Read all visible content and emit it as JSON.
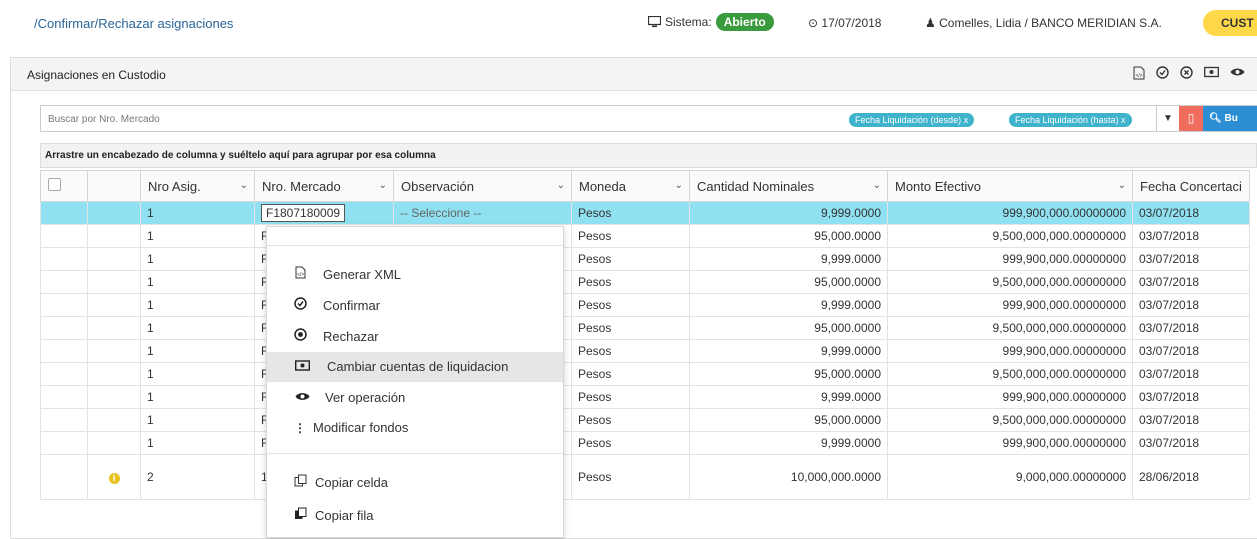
{
  "header": {
    "breadcrumb": "/Confirmar/Rechazar asignaciones",
    "system_label": "Sistema:",
    "system_status": "Abierto",
    "date": "17/07/2018",
    "user": "Comelles, Lidia / BANCO MERIDIAN S.A.",
    "role_badge": "CUST"
  },
  "panel": {
    "title": "Asignaciones en Custodio"
  },
  "search": {
    "placeholder": "Buscar por Nro. Mercado",
    "chips": [
      "Fecha Liquidación (desde) x",
      "Fecha Liquidación (hasta) x"
    ],
    "find_label": "Bu"
  },
  "group_hint": "Arrastre un encabezado de columna y suéltelo aquí para agrupar por esa columna",
  "columns": [
    "Nro Asig.",
    "Nro. Mercado",
    "Observación",
    "Moneda",
    "Cantidad Nominales",
    "Monto Efectivo",
    "Fecha Concertaci"
  ],
  "rows": [
    {
      "asig": "1",
      "mercado": "F1807180009",
      "obs": "-- Seleccione --",
      "moneda": "Pesos",
      "cantidad": "9,999.0000",
      "monto": "999,900,000.00000000",
      "fecha": "03/07/2018",
      "info": false
    },
    {
      "asig": "1",
      "mercado": "F",
      "obs": "",
      "moneda": "Pesos",
      "cantidad": "95,000.0000",
      "monto": "9,500,000,000.00000000",
      "fecha": "03/07/2018",
      "info": false
    },
    {
      "asig": "1",
      "mercado": "F",
      "obs": "",
      "moneda": "Pesos",
      "cantidad": "9,999.0000",
      "monto": "999,900,000.00000000",
      "fecha": "03/07/2018",
      "info": false
    },
    {
      "asig": "1",
      "mercado": "F",
      "obs": "",
      "moneda": "Pesos",
      "cantidad": "95,000.0000",
      "monto": "9,500,000,000.00000000",
      "fecha": "03/07/2018",
      "info": false
    },
    {
      "asig": "1",
      "mercado": "F",
      "obs": "",
      "moneda": "Pesos",
      "cantidad": "9,999.0000",
      "monto": "999,900,000.00000000",
      "fecha": "03/07/2018",
      "info": false
    },
    {
      "asig": "1",
      "mercado": "F",
      "obs": "",
      "moneda": "Pesos",
      "cantidad": "95,000.0000",
      "monto": "9,500,000,000.00000000",
      "fecha": "03/07/2018",
      "info": false
    },
    {
      "asig": "1",
      "mercado": "F",
      "obs": "",
      "moneda": "Pesos",
      "cantidad": "9,999.0000",
      "monto": "999,900,000.00000000",
      "fecha": "03/07/2018",
      "info": false
    },
    {
      "asig": "1",
      "mercado": "F",
      "obs": "",
      "moneda": "Pesos",
      "cantidad": "95,000.0000",
      "monto": "9,500,000,000.00000000",
      "fecha": "03/07/2018",
      "info": false
    },
    {
      "asig": "1",
      "mercado": "F",
      "obs": "",
      "moneda": "Pesos",
      "cantidad": "9,999.0000",
      "monto": "999,900,000.00000000",
      "fecha": "03/07/2018",
      "info": false
    },
    {
      "asig": "1",
      "mercado": "F",
      "obs": "",
      "moneda": "Pesos",
      "cantidad": "95,000.0000",
      "monto": "9,500,000,000.00000000",
      "fecha": "03/07/2018",
      "info": false
    },
    {
      "asig": "1",
      "mercado": "F",
      "obs": "",
      "moneda": "Pesos",
      "cantidad": "9,999.0000",
      "monto": "999,900,000.00000000",
      "fecha": "03/07/2018",
      "info": false
    },
    {
      "asig": "2",
      "mercado": "1",
      "obs": "",
      "moneda": "Pesos",
      "cantidad": "10,000,000.0000",
      "monto": "9,000,000.00000000",
      "fecha": "28/06/2018",
      "info": true
    }
  ],
  "context_menu": {
    "items": [
      {
        "label": "Generar XML",
        "icon": "xml-file-icon"
      },
      {
        "label": "Confirmar",
        "icon": "check-circle-icon"
      },
      {
        "label": "Rechazar",
        "icon": "x-circle-icon"
      },
      {
        "label": "Cambiar cuentas de liquidacion",
        "icon": "money-icon",
        "highlighted": true
      },
      {
        "label": "Ver operación",
        "icon": "eye-icon"
      },
      {
        "label": "Modificar fondos",
        "icon": "vertical-dots-icon"
      },
      {
        "label": "Copiar celda",
        "icon": "copy-icon"
      },
      {
        "label": "Copiar fila",
        "icon": "copy-row-icon"
      }
    ]
  },
  "colors": {
    "selected_row": "#8fe0f0",
    "open_badge": "#3a9a3e",
    "cust_badge": "#ffd84a",
    "chip": "#3fb2cc"
  }
}
